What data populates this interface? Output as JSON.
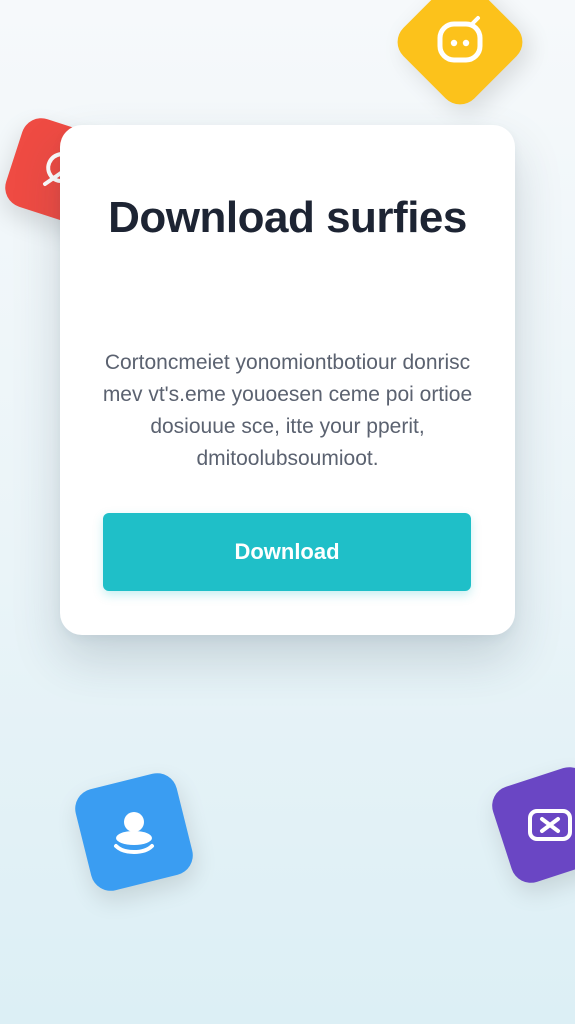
{
  "card": {
    "title": "Download surfies",
    "body": "Cortoncmeiet yonomiontbotiour donrisc mev vt's.eme youoesen ceme poi ortioe dosiouue sce, itte your pperit, dmitoolubsoumioot.",
    "button_label": "Download"
  },
  "decor_icons": [
    {
      "name": "chat-app-icon",
      "color": "#fcc21b"
    },
    {
      "name": "red-app-icon",
      "color": "#ef4b43"
    },
    {
      "name": "blue-app-icon",
      "color": "#3a9df2"
    },
    {
      "name": "purple-app-icon",
      "color": "#6a46c4"
    }
  ],
  "colors": {
    "accent": "#1fbfc8",
    "title": "#1d2433",
    "body_text": "#5b6270"
  }
}
